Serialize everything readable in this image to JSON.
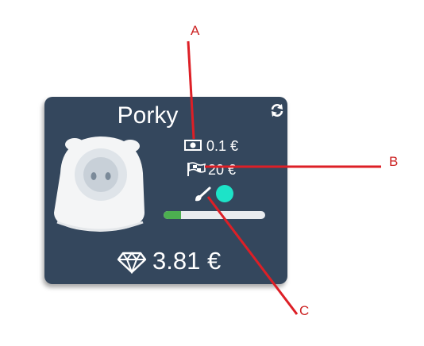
{
  "card": {
    "name": "Porky",
    "balance": "3.81 €",
    "stats": {
      "cost": "0.1 €",
      "goal": "20 €"
    },
    "progress": 0.17,
    "colors": {
      "card_bg": "#34475d",
      "dot": "#1de3c8",
      "progress_fill": "#4caf50",
      "progress_track": "#e9ecef"
    },
    "icons": {
      "refresh": "refresh-icon",
      "piggy": "piggy-bank-icon",
      "cost": "money-bill-icon",
      "goal": "flag-checkered-icon",
      "edit": "paint-brush-icon",
      "balance": "diamond-icon"
    }
  },
  "annotations": {
    "a": "A",
    "b": "B",
    "c": "C",
    "color": "#dd1f26"
  }
}
